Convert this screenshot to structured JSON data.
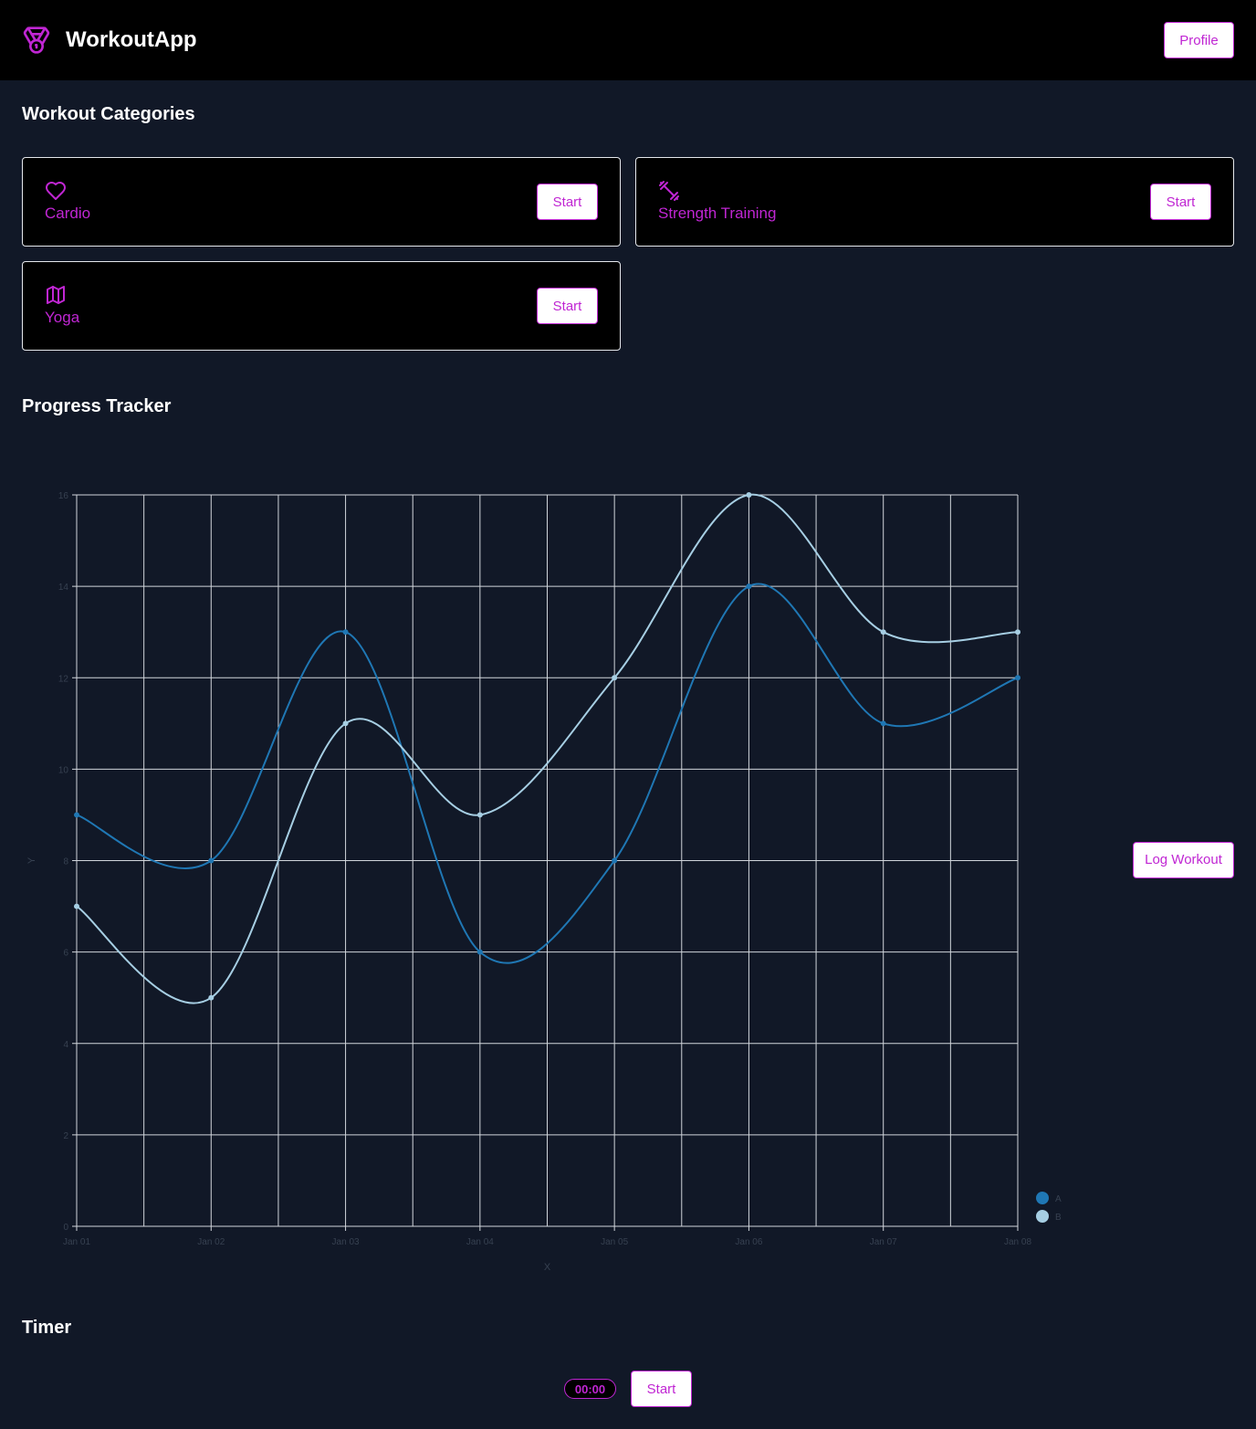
{
  "header": {
    "app_title": "WorkoutApp",
    "logo_icon": "medal-icon",
    "profile_label": "Profile"
  },
  "sections": {
    "categories_title": "Workout Categories",
    "progress_title": "Progress Tracker",
    "timer_title": "Timer"
  },
  "categories": [
    {
      "name": "Cardio",
      "icon": "heart-icon",
      "button": "Start"
    },
    {
      "name": "Strength Training",
      "icon": "dumbbell-icon",
      "button": "Start"
    },
    {
      "name": "Yoga",
      "icon": "map-icon",
      "button": "Start"
    }
  ],
  "log_workout_label": "Log Workout",
  "timer": {
    "display": "00:00",
    "button": "Start"
  },
  "colors": {
    "accent": "#c026d3",
    "background": "#111827",
    "series_a": "#1f77b4",
    "series_b": "#a6cee3"
  },
  "chart_data": {
    "type": "line",
    "x": [
      "Jan 01",
      "Jan 02",
      "Jan 03",
      "Jan 04",
      "Jan 05",
      "Jan 06",
      "Jan 07",
      "Jan 08"
    ],
    "series": [
      {
        "name": "A",
        "values": [
          9,
          8,
          13,
          6,
          8,
          14,
          11,
          12
        ]
      },
      {
        "name": "B",
        "values": [
          7,
          5,
          11,
          9,
          12,
          16,
          13,
          13
        ]
      }
    ],
    "xlabel": "X",
    "ylabel": "Y",
    "ylim": [
      0,
      16
    ],
    "yticks": [
      0,
      2,
      4,
      6,
      8,
      10,
      12,
      14,
      16
    ],
    "grid": true,
    "legend_position": "bottom-right"
  }
}
